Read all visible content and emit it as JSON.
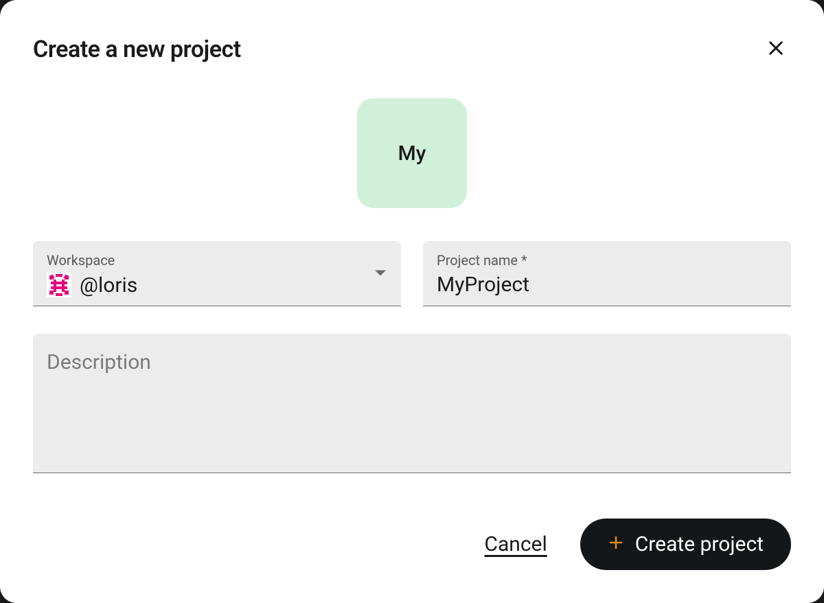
{
  "dialog": {
    "title": "Create a new project"
  },
  "avatar": {
    "text": "My",
    "bg_color": "#d1f0da"
  },
  "workspace": {
    "label": "Workspace",
    "value": "@loris"
  },
  "project_name": {
    "label": "Project name *",
    "value": "MyProject"
  },
  "description": {
    "placeholder": "Description",
    "value": ""
  },
  "actions": {
    "cancel_label": "Cancel",
    "create_label": "Create project"
  },
  "icons": {
    "close": "close-icon",
    "dropdown": "chevron-down-icon",
    "plus": "plus-icon",
    "workspace_avatar": "identicon-icon"
  }
}
